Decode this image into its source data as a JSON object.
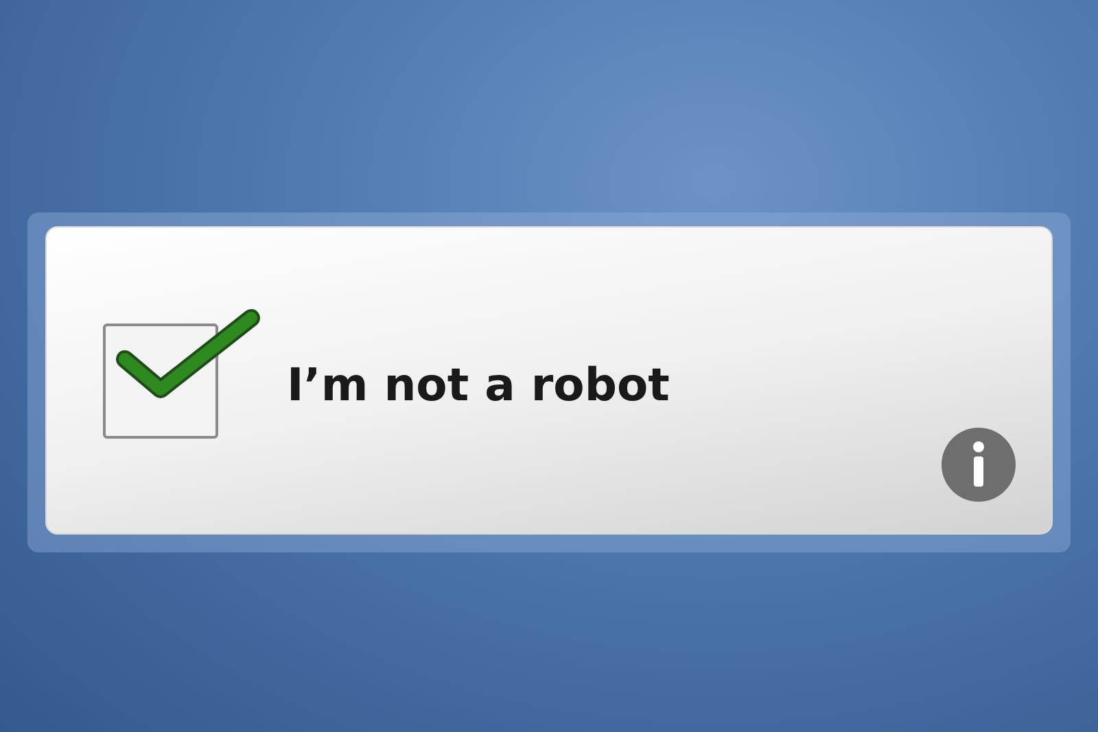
{
  "captcha": {
    "checked": true,
    "label": "I’m not a robot"
  }
}
